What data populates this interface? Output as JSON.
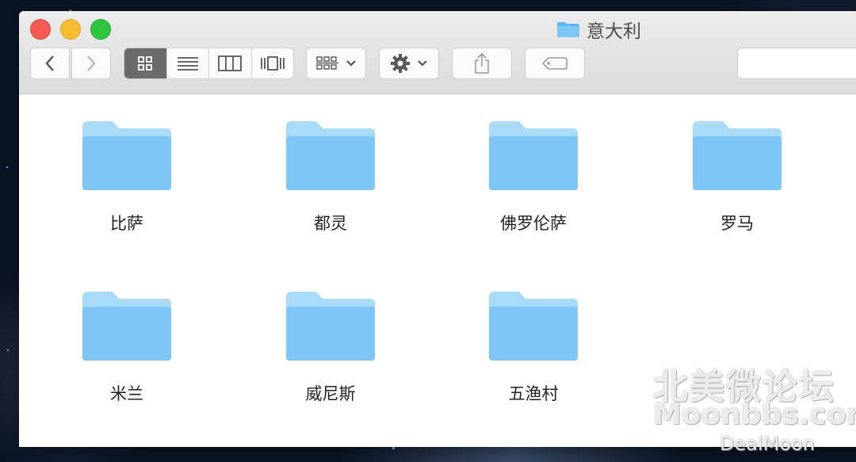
{
  "window": {
    "title": "意大利",
    "title_icon": "folder-icon"
  },
  "toolbar": {
    "back_icon": "chevron-left-icon",
    "forward_icon": "chevron-right-icon",
    "view_modes": [
      {
        "name": "icon-view",
        "icon": "grid-icon",
        "active": true
      },
      {
        "name": "list-view",
        "icon": "list-icon",
        "active": false
      },
      {
        "name": "column-view",
        "icon": "columns-icon",
        "active": false
      },
      {
        "name": "cover-flow-view",
        "icon": "cover-flow-icon",
        "active": false
      }
    ],
    "group_icon": "group-icon",
    "action_icon": "gear-icon",
    "share_icon": "share-icon",
    "tag_icon": "tag-icon",
    "search_value": ""
  },
  "items": [
    {
      "label": "比萨"
    },
    {
      "label": "都灵"
    },
    {
      "label": "佛罗伦萨"
    },
    {
      "label": "罗马"
    },
    {
      "label": "米兰"
    },
    {
      "label": "威尼斯"
    },
    {
      "label": "五渔村"
    }
  ],
  "watermarks": {
    "line1": "北美微论坛",
    "line2": "Moonbbs.com",
    "line3": "DealMoon"
  },
  "colors": {
    "folder": "#7ec6f5",
    "folder_tab": "#a9daf8",
    "active_segment": "#6b6b6b"
  }
}
